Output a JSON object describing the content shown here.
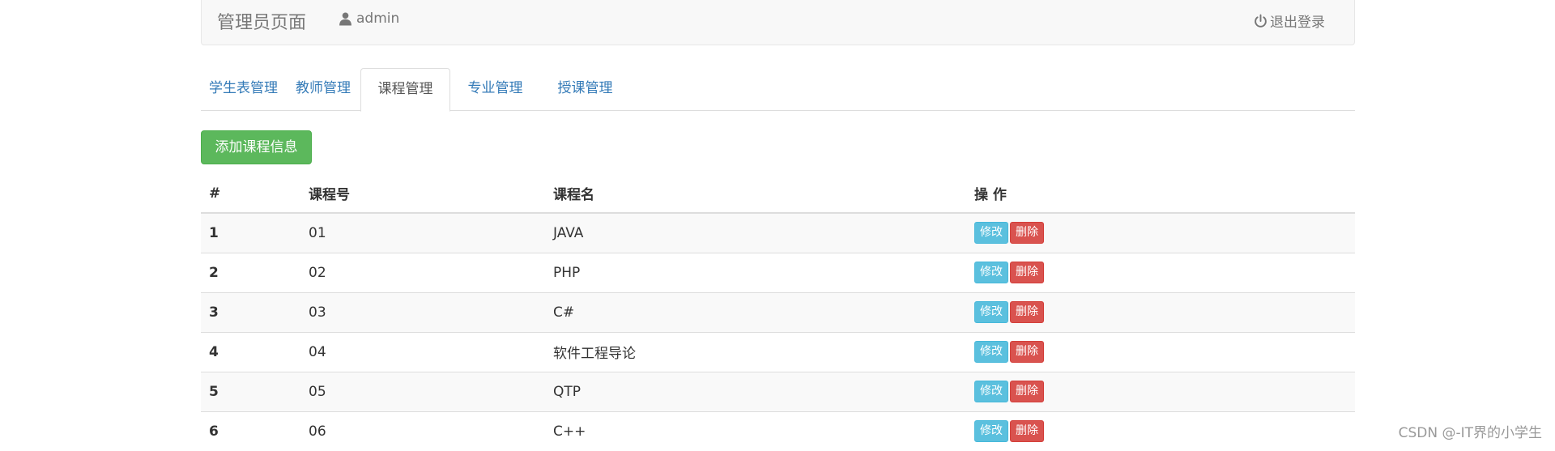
{
  "navbar": {
    "brand": "管理员页面",
    "user_icon": "user-icon",
    "username": "admin",
    "logout_icon": "power-icon",
    "logout_label": "退出登录"
  },
  "tabs": [
    {
      "label": "学生表管理",
      "active": false
    },
    {
      "label": "教师管理",
      "active": false
    },
    {
      "label": "课程管理",
      "active": true
    },
    {
      "label": "专业管理",
      "active": false
    },
    {
      "label": "授课管理",
      "active": false
    }
  ],
  "add_button_label": "添加课程信息",
  "table": {
    "headers": [
      "#",
      "课程号",
      "课程名",
      "操 作"
    ],
    "edit_label": "修改",
    "delete_label": "删除",
    "rows": [
      {
        "idx": "1",
        "no": "01",
        "name": "JAVA"
      },
      {
        "idx": "2",
        "no": "02",
        "name": "PHP"
      },
      {
        "idx": "3",
        "no": "03",
        "name": "C#"
      },
      {
        "idx": "4",
        "no": "04",
        "name": "软件工程导论"
      },
      {
        "idx": "5",
        "no": "05",
        "name": "QTP"
      },
      {
        "idx": "6",
        "no": "06",
        "name": "C++"
      }
    ]
  },
  "watermark": "CSDN @-IT界的小学生",
  "colors": {
    "success": "#5cb85c",
    "info": "#5bc0de",
    "danger": "#d9534f",
    "link": "#337ab7"
  }
}
